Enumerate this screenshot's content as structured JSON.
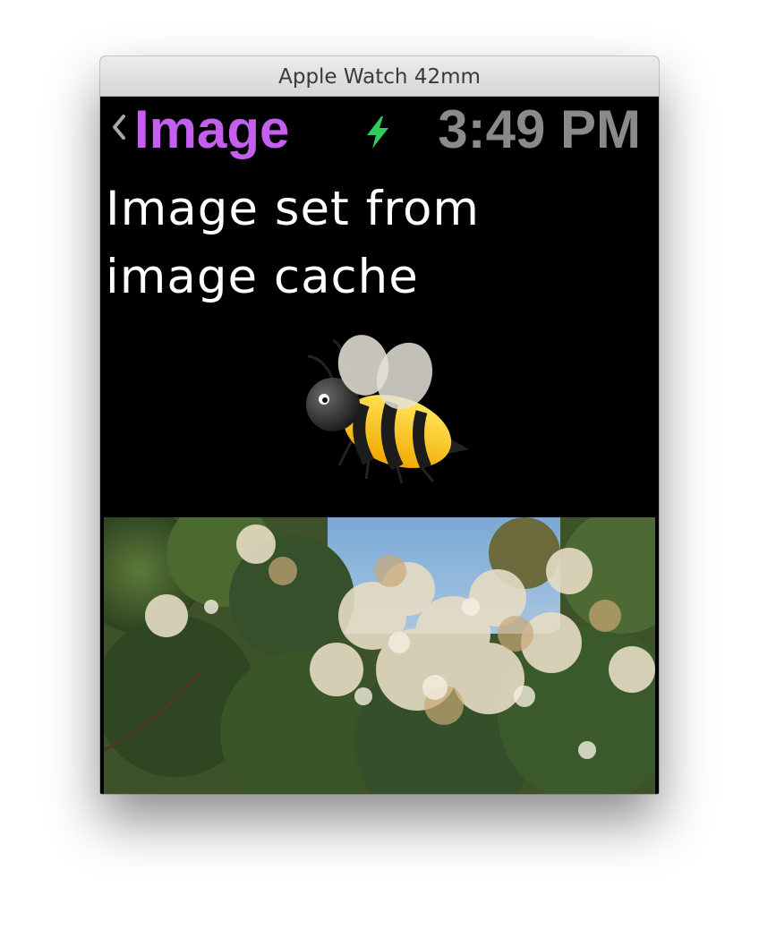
{
  "window": {
    "title": "Apple Watch 42mm"
  },
  "nav": {
    "back_icon": "chevron-left-icon",
    "title": "Image",
    "status_icon": "charging-bolt-icon",
    "time": "3:49 PM"
  },
  "content": {
    "label_text": "Image set from image cache",
    "emoji_image": "bee-emoji",
    "photo_image": "flowering-tree-photo"
  },
  "colors": {
    "title_accent": "#c45ff0",
    "charging_green": "#2ecc59",
    "time_gray": "#8a8a8a",
    "background": "#000000"
  }
}
